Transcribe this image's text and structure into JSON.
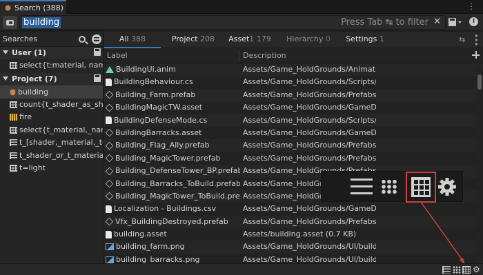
{
  "window": {
    "tab_title": "Search (388)"
  },
  "search": {
    "query": "building",
    "hint": "Press Tab ↹ to filter",
    "clear_glyph": "✕"
  },
  "sidebar": {
    "header": "Searches",
    "groups": [
      {
        "label": "User (1)",
        "items": [
          {
            "icon": "grid-icon",
            "label": "select{t:material, name, #m"
          }
        ]
      },
      {
        "label": "Project (7)",
        "items": [
          {
            "icon": "potion-icon",
            "label": "building",
            "selected": true
          },
          {
            "icon": "grid-icon",
            "label": "count{t_shader_as_shader"
          },
          {
            "icon": "fire-icon",
            "label": "fire"
          },
          {
            "icon": "grid-icon",
            "label": "select{t_material,_name,_#"
          },
          {
            "icon": "list-icon",
            "label": "t_[shader,_material,_textur"
          },
          {
            "icon": "list-icon",
            "label": "t_shader_or_t_material_or_"
          },
          {
            "icon": "grid-icon",
            "label": "t=light"
          }
        ]
      }
    ]
  },
  "provider_tabs": [
    {
      "label": "All",
      "count": "388",
      "active": true
    },
    {
      "label": "Project",
      "count": "208"
    },
    {
      "label": "Asset",
      "count": "1 179"
    },
    {
      "label": "Hierarchy",
      "count": "0",
      "dim": true
    },
    {
      "label": "Settings",
      "count": "1"
    }
  ],
  "table": {
    "columns": [
      "Label",
      "Description"
    ],
    "rows": [
      {
        "icon": "anim",
        "label": "BuildingUi.anim",
        "desc": "Assets/Game_HoldGrounds/Animation/B"
      },
      {
        "icon": "doc",
        "label": "BuildingBehaviour.cs",
        "desc": "Assets/Game_HoldGrounds/Scripts/Builc"
      },
      {
        "icon": "cube",
        "label": "Building_Farm.prefab",
        "desc": "Assets/Game_HoldGrounds/Prefabs/Buil"
      },
      {
        "icon": "cube",
        "label": "BuildingMagicTW.asset",
        "desc": "Assets/Game_HoldGrounds/GameData/E"
      },
      {
        "icon": "doc",
        "label": "BuildingDefenseMode.cs",
        "desc": "Assets/Game_HoldGrounds/Scripts/Builc"
      },
      {
        "icon": "cube",
        "label": "BuildingBarracks.asset",
        "desc": "Assets/Game_HoldGrounds/GameData/E"
      },
      {
        "icon": "cube",
        "label": "Building_Flag_Ally.prefab",
        "desc": "Assets/Game_HoldGrounds/Prefabs/Sce"
      },
      {
        "icon": "cube",
        "label": "Building_MagicTower.prefab",
        "desc": "Assets/Game_HoldGrounds/Prefabs/Buil"
      },
      {
        "icon": "cube",
        "label": "Building_DefenseTower_BP.prefab",
        "desc": "Assets/Game_HoldGrounds/Prefabs/Buil"
      },
      {
        "icon": "cube",
        "label": "Building_Barracks_ToBuild.prefab",
        "desc": "Assets/Game_HoldGrounds/Prefabs/Buil"
      },
      {
        "icon": "cube",
        "label": "Building_MagicTower_ToBuild.prefab",
        "desc": "Assets/Game_HoldGrounds/Prefabs/Buil"
      },
      {
        "icon": "doc",
        "label": "Localization - Buildings.csv",
        "desc": "Assets/Game_HoldGrounds/GameData/L"
      },
      {
        "icon": "cube",
        "label": "Vfx_BuildingDestroyed.prefab",
        "desc": "Assets/Game_HoldGrounds/Prefabs/Vfx/"
      },
      {
        "icon": "doc",
        "label": "building.asset",
        "desc": "Assets/building.asset (0.7 KB)"
      },
      {
        "icon": "img",
        "label": "building_farm.png",
        "desc": "Assets/Game_HoldGrounds/UI/building_f"
      },
      {
        "icon": "img",
        "label": "building_barracks.png",
        "desc": "Assets/Game_HoldGrounds/UI/building_t"
      }
    ]
  },
  "colors": {
    "accent": "#3a79bb",
    "highlight": "#d04040",
    "selection": "#2c5d97"
  }
}
